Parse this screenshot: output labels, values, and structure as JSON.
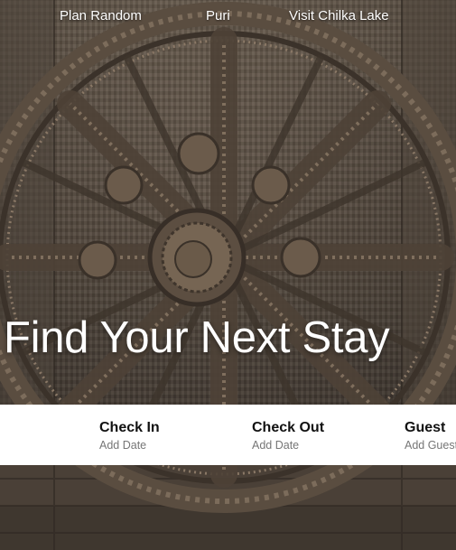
{
  "nav": {
    "links": [
      {
        "label": "Plan Random"
      },
      {
        "label": "Puri"
      },
      {
        "label": "Visit Chilka Lake"
      }
    ]
  },
  "hero": {
    "title": "Find Your Next Stay",
    "background": "Konark Sun Temple stone chariot wheel"
  },
  "search": {
    "fields": [
      {
        "label": "Check In",
        "value": "Add Date"
      },
      {
        "label": "Check Out",
        "value": "Add Date"
      },
      {
        "label": "Guest",
        "value": "Add Guests"
      }
    ]
  },
  "colors": {
    "stone": "#6d6052",
    "text_light": "#ffffff",
    "search_bg": "#ffffff",
    "label": "#111111",
    "muted": "#767676"
  }
}
